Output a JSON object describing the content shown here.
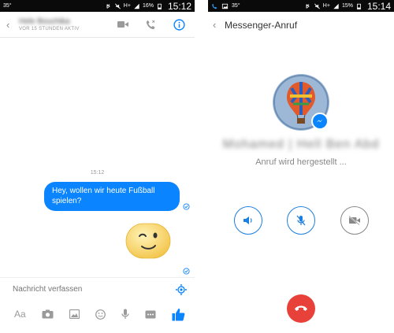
{
  "left_screen": {
    "status_bar": {
      "temperature": "35°",
      "network": "H+",
      "battery": "16%",
      "time": "15:12"
    },
    "header": {
      "contact_name": "Hele Bouchika",
      "contact_status": "VOR 15 STUNDEN AKTIV",
      "icons": [
        "back-chevron-icon",
        "video-camera-icon",
        "phone-icon",
        "info-icon"
      ]
    },
    "messages": [
      {
        "time": "15:12",
        "text": "Hey, wollen wir heute Fußball spielen?",
        "sender": "me"
      },
      {
        "type": "sticker",
        "sticker": "winking-face"
      }
    ],
    "composer": {
      "placeholder": "Nachricht verfassen"
    },
    "toolbar": {
      "text_button": "Aa",
      "icons": [
        "camera-icon",
        "image-icon",
        "emoji-icon",
        "microphone-icon",
        "more-icon",
        "thumbs-up-icon"
      ]
    }
  },
  "right_screen": {
    "status_bar": {
      "temperature": "35°",
      "network": "H+",
      "battery": "15%",
      "time": "15:14"
    },
    "header": {
      "title": "Messenger-Anruf"
    },
    "caller": {
      "name": "Mohamed | Hell Ben Abd",
      "status": "Anruf wird hergestellt ..."
    },
    "controls": [
      "speaker-icon",
      "mute-microphone-icon",
      "video-off-icon"
    ],
    "end_call": "hang-up-icon"
  },
  "colors": {
    "accent": "#0b84ff",
    "hangup": "#e8413a",
    "statusbar": "#0a0a0a"
  }
}
